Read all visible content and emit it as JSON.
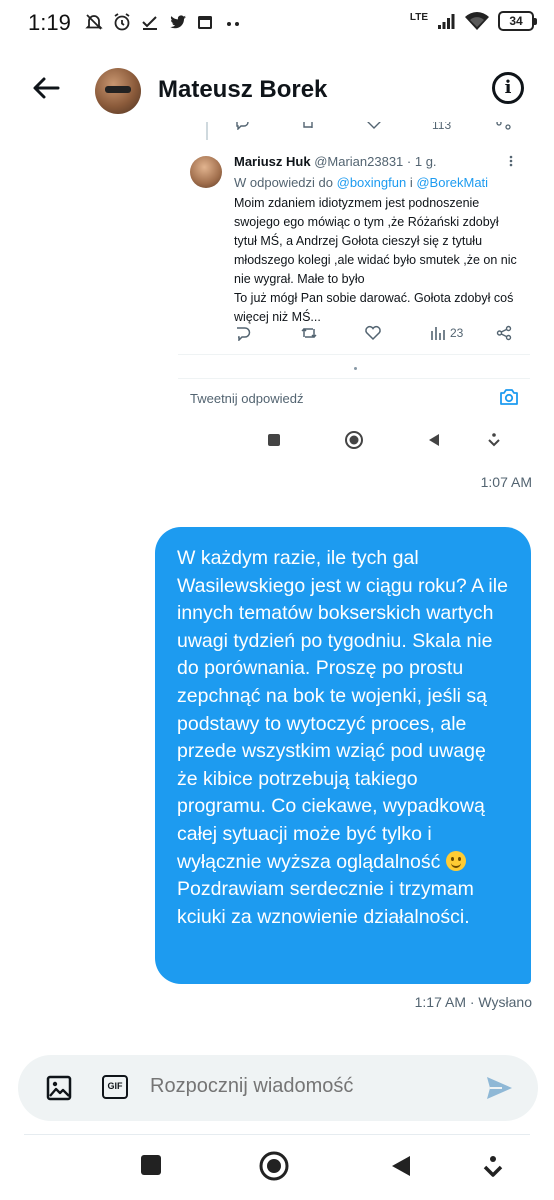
{
  "status_bar": {
    "time": "1:19",
    "network_label": "LTE",
    "battery": "34",
    "icons": [
      "muted-bell-icon",
      "alarm-icon",
      "check-icon",
      "twitter-icon",
      "calendar-icon",
      "more-dots-icon",
      "signal-icon",
      "wifi-icon",
      "battery-icon"
    ]
  },
  "header": {
    "contact_name": "Mateusz Borek",
    "back_icon": "arrow-left-icon",
    "info_icon": "info-icon"
  },
  "embedded_tweet": {
    "top_counts": {
      "views": "113"
    },
    "author_name": "Mariusz Huk",
    "author_handle": "@Marian23831",
    "time": "· 1 g.",
    "reply_prefix": "W odpowiedzi do",
    "reply_user_1": "@boxingfun",
    "reply_join": "i",
    "reply_user_2": "@BorekMati",
    "text": "Moim zdaniem idiotyzmem jest podnoszenie swojego ego mówiąc o tym ,że Różański zdobył tytuł MŚ, a Andrzej Gołota cieszył się z tytułu młodszego kolegi ,ale widać było smutek ,że on nic nie wygrał. Małe to było",
    "text_2": "To już mógł Pan sobie darować. Gołota zdobył coś więcej niż MŚ...",
    "views": "23",
    "reply_placeholder": "Tweetnij odpowiedź"
  },
  "messages": {
    "received_time": "1:07 AM",
    "sent_text": "W każdym razie, ile tych gal Wasilewskiego jest w ciągu roku? A ile innych tematów bokserskich wartych uwagi tydzień po tygodniu. Skala nie do porównania. Proszę po prostu zepchnąć na bok te wojenki, jeśli są podstawy to wytoczyć proces, ale przede wszystkim wziąć pod uwagę że kibice potrzebują takiego programu. Co ciekawe, wypadkową całej sytuacji może być tylko i wyłącznie wyższa oglądalność",
    "sent_text_end": " Pozdrawiam serdecznie i trzymam kciuki za wznowienie działalności.",
    "sent_meta": "1:17 AM · Wysłano"
  },
  "composer": {
    "placeholder": "Rozpocznij wiadomość",
    "gif_label": "GIF"
  },
  "colors": {
    "accent": "#1d9bf0",
    "text": "#0f1419",
    "muted": "#536471",
    "composer_bg": "#eff3f4"
  }
}
